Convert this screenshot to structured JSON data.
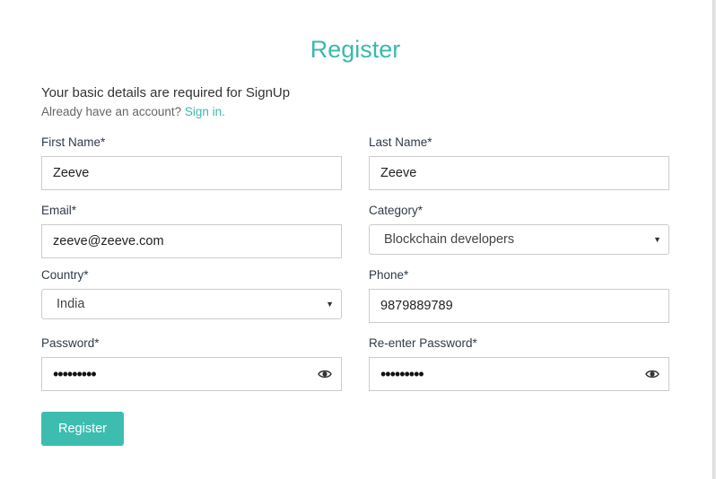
{
  "header": {
    "title": "Register",
    "subtitle": "Your basic details are required for SignUp",
    "account_prompt": "Already have an account?",
    "signin_link": "Sign in."
  },
  "form": {
    "first_name": {
      "label": "First Name*",
      "value": "Zeeve"
    },
    "last_name": {
      "label": "Last Name*",
      "value": "Zeeve"
    },
    "email": {
      "label": "Email*",
      "value": "zeeve@zeeve.com"
    },
    "category": {
      "label": "Category*",
      "value": "Blockchain developers"
    },
    "country": {
      "label": "Country*",
      "value": "India"
    },
    "phone": {
      "label": "Phone*",
      "value": "9879889789"
    },
    "password": {
      "label": "Password*",
      "value": "•••••••••"
    },
    "reenter_password": {
      "label": "Re-enter Password*",
      "value": "•••••••••"
    }
  },
  "actions": {
    "register_label": "Register"
  },
  "colors": {
    "accent": "#3bb8ae",
    "button": "#3cbdb0",
    "border": "#cccccc"
  },
  "icons": {
    "dropdown": "chevron-down-icon",
    "password_toggle": "eye-icon"
  }
}
